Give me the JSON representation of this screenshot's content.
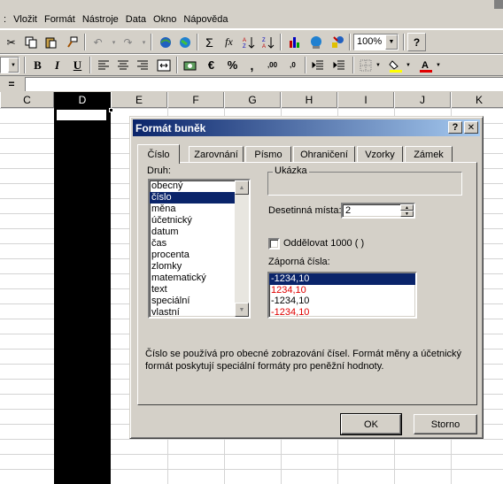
{
  "menu": [
    "Vložit",
    "Formát",
    "Nástroje",
    "Data",
    "Okno",
    "Nápověda"
  ],
  "toolbar1": {
    "zoom": "100%",
    "sum_symbol": "Σ",
    "fx_label": "fx"
  },
  "toolbar2": {
    "bold": "B",
    "italic": "I",
    "underline": "U",
    "currency": "€",
    "percent": "%",
    "comma": ",",
    "inc_decimal": ",00",
    "dec_decimal": ",0"
  },
  "formula_bar": {
    "equals": "="
  },
  "columns": [
    "C",
    "D",
    "E",
    "F",
    "G",
    "H",
    "I",
    "J",
    "K"
  ],
  "selected_column": "D",
  "dialog": {
    "title": "Formát buněk",
    "help_btn": "?",
    "close_btn": "✕",
    "tabs": [
      "Číslo",
      "Zarovnání",
      "Písmo",
      "Ohraničení",
      "Vzorky",
      "Zámek"
    ],
    "active_tab": "Číslo",
    "druh_label": "Druh:",
    "druh_items": [
      "obecný",
      "číslo",
      "měna",
      "účetnický",
      "datum",
      "čas",
      "procenta",
      "zlomky",
      "matematický",
      "text",
      "speciální",
      "vlastní"
    ],
    "druh_selected": "číslo",
    "ukazka_label": "Ukázka",
    "decimal_label": "Desetinná místa:",
    "decimal_value": "2",
    "separator_label": "Oddělovat 1000 ( )",
    "separator_checked": false,
    "negative_label": "Záporná čísla:",
    "negative_items": [
      {
        "text": "-1234,10",
        "color": "#000000",
        "selected": true
      },
      {
        "text": "1234,10",
        "color": "#e00000"
      },
      {
        "text": "-1234,10",
        "color": "#000000"
      },
      {
        "text": "-1234,10",
        "color": "#e00000"
      }
    ],
    "description": "Číslo se používá pro obecné zobrazování čísel. Formát měny a účetnický formát poskytují speciální formáty pro peněžní hodnoty.",
    "ok": "OK",
    "cancel": "Storno"
  }
}
